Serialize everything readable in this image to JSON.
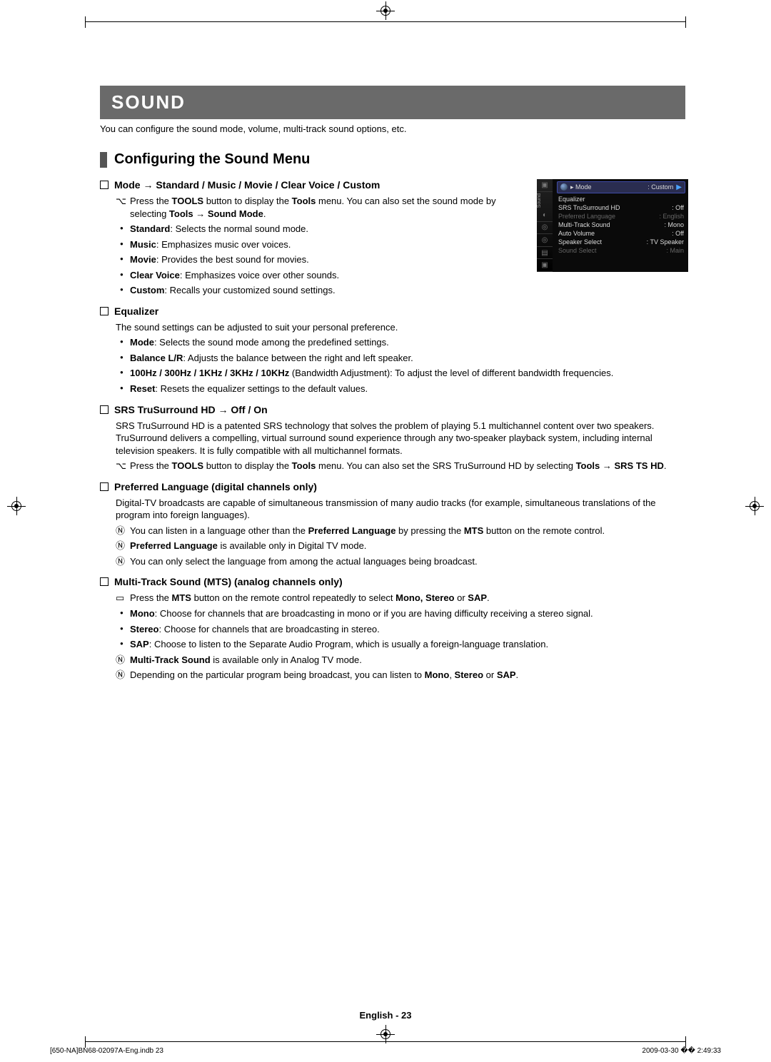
{
  "banner": "SOUND",
  "intro": "You can configure the sound mode, volume, multi-track sound options, etc.",
  "section_title": "Configuring the Sound Menu",
  "mode": {
    "heading": "Mode → Standard / Music / Movie / Clear Voice / Custom",
    "tools_note_a": "Press the ",
    "tools_note_b": "TOOLS",
    "tools_note_c": " button to display the ",
    "tools_note_d": "Tools",
    "tools_note_e": " menu. You can also set the sound mode by selecting ",
    "tools_note_f": "Tools → Sound Mode",
    "tools_note_g": ".",
    "items": [
      {
        "k": "Standard",
        "v": ": Selects the normal sound mode."
      },
      {
        "k": "Music",
        "v": ": Emphasizes music over voices."
      },
      {
        "k": "Movie",
        "v": ": Provides the best sound for movies."
      },
      {
        "k": "Clear Voice",
        "v": ": Emphasizes voice over other sounds."
      },
      {
        "k": "Custom",
        "v": ": Recalls your customized sound settings."
      }
    ]
  },
  "equalizer": {
    "heading": "Equalizer",
    "intro": "The sound settings can be adjusted to suit your personal preference.",
    "items": [
      {
        "k": "Mode",
        "v": ": Selects the sound mode among the predefined settings."
      },
      {
        "k": "Balance L/R",
        "v": ": Adjusts the balance between the right and left speaker."
      },
      {
        "k": "100Hz / 300Hz / 1KHz / 3KHz / 10KHz",
        "v": " (Bandwidth Adjustment): To adjust the level of different bandwidth frequencies."
      },
      {
        "k": "Reset",
        "v": ": Resets the equalizer settings to the default values."
      }
    ]
  },
  "srs": {
    "heading": "SRS TruSurround HD → Off / On",
    "para": "SRS TruSurround HD is a patented SRS technology that solves the problem of playing 5.1 multichannel content over two speakers. TruSurround delivers a compelling, virtual surround sound experience through any two-speaker playback system, including internal television speakers. It is fully compatible with all multichannel formats.",
    "tools_a": "Press the ",
    "tools_b": "TOOLS",
    "tools_c": " button to display the ",
    "tools_d": "Tools",
    "tools_e": " menu. You can also set the SRS TruSurround HD by selecting ",
    "tools_f": "Tools → SRS TS HD",
    "tools_g": "."
  },
  "pref_lang": {
    "heading": "Preferred Language (digital channels only)",
    "para": "Digital-TV broadcasts are capable of simultaneous transmission of many audio tracks (for example, simultaneous translations of the program into foreign languages).",
    "n1_a": "You can listen in a language other than the ",
    "n1_b": "Preferred Language",
    "n1_c": " by pressing the ",
    "n1_d": "MTS",
    "n1_e": " button on the remote control.",
    "n2_a": "Preferred Language",
    "n2_b": " is available only in Digital TV mode.",
    "n3": "You can only select the language from among the actual languages being broadcast."
  },
  "mts": {
    "heading": "Multi-Track Sound (MTS) (analog channels only)",
    "r1_a": "Press the ",
    "r1_b": "MTS",
    "r1_c": " button on the remote control repeatedly to select ",
    "r1_d": "Mono, Stereo",
    "r1_e": " or ",
    "r1_f": "SAP",
    "r1_g": ".",
    "items": [
      {
        "k": "Mono",
        "v": ": Choose for channels that are broadcasting in mono or if you are having difficulty receiving a stereo signal."
      },
      {
        "k": "Stereo",
        "v": ": Choose for channels that are broadcasting in stereo."
      },
      {
        "k": "SAP",
        "v": ": Choose to listen to the Separate Audio Program, which is usually a foreign-language translation."
      }
    ],
    "n1_a": "Multi-Track Sound",
    "n1_b": " is available only in Analog TV mode.",
    "n2_a": "Depending on the particular program being broadcast, you can listen to ",
    "n2_b": "Mono",
    "n2_c": ", ",
    "n2_d": "Stereo",
    "n2_e": " or ",
    "n2_f": "SAP",
    "n2_g": "."
  },
  "osd": {
    "side_label": "Sound",
    "rows": [
      {
        "label": "Mode",
        "value": ": Custom",
        "hl": true,
        "bullet": true
      },
      {
        "label": "Equalizer",
        "value": ""
      },
      {
        "label": "SRS TruSurround HD",
        "value": ": Off"
      },
      {
        "label": "Preferred Language",
        "value": ": English",
        "dim": true
      },
      {
        "label": "Multi-Track Sound",
        "value": ": Mono"
      },
      {
        "label": "Auto Volume",
        "value": ": Off"
      },
      {
        "label": "Speaker Select",
        "value": ": TV Speaker"
      },
      {
        "label": "Sound Select",
        "value": ": Main",
        "dim": true
      }
    ]
  },
  "footer": "English - 23",
  "print_left": "[650-NA]BN68-02097A-Eng.indb   23",
  "print_right": "2009-03-30   �� 2:49:33"
}
